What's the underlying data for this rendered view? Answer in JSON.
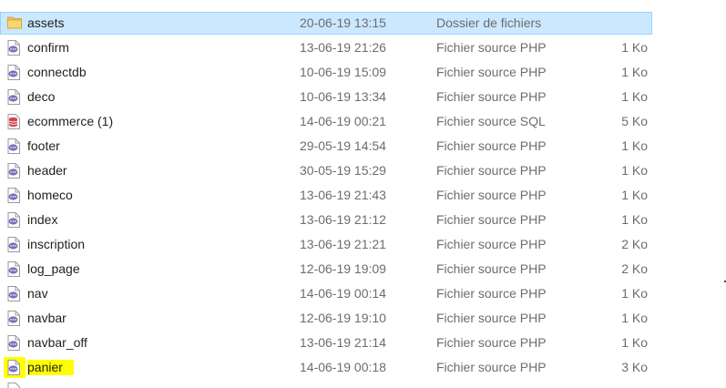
{
  "files": [
    {
      "name": "assets",
      "modified": "20-06-19 13:15",
      "type": "Dossier de fichiers",
      "size": "",
      "icon": "folder-icon",
      "selected": true,
      "highlighted": false
    },
    {
      "name": "confirm",
      "modified": "13-06-19 21:26",
      "type": "Fichier source PHP",
      "size": "1 Ko",
      "icon": "php-file-icon",
      "selected": false,
      "highlighted": false
    },
    {
      "name": "connectdb",
      "modified": "10-06-19 15:09",
      "type": "Fichier source PHP",
      "size": "1 Ko",
      "icon": "php-file-icon",
      "selected": false,
      "highlighted": false
    },
    {
      "name": "deco",
      "modified": "10-06-19 13:34",
      "type": "Fichier source PHP",
      "size": "1 Ko",
      "icon": "php-file-icon",
      "selected": false,
      "highlighted": false
    },
    {
      "name": "ecommerce (1)",
      "modified": "14-06-19 00:21",
      "type": "Fichier source SQL",
      "size": "5 Ko",
      "icon": "sql-file-icon",
      "selected": false,
      "highlighted": false
    },
    {
      "name": "footer",
      "modified": "29-05-19 14:54",
      "type": "Fichier source PHP",
      "size": "1 Ko",
      "icon": "php-file-icon",
      "selected": false,
      "highlighted": false
    },
    {
      "name": "header",
      "modified": "30-05-19 15:29",
      "type": "Fichier source PHP",
      "size": "1 Ko",
      "icon": "php-file-icon",
      "selected": false,
      "highlighted": false
    },
    {
      "name": "homeco",
      "modified": "13-06-19 21:43",
      "type": "Fichier source PHP",
      "size": "1 Ko",
      "icon": "php-file-icon",
      "selected": false,
      "highlighted": false
    },
    {
      "name": "index",
      "modified": "13-06-19 21:12",
      "type": "Fichier source PHP",
      "size": "1 Ko",
      "icon": "php-file-icon",
      "selected": false,
      "highlighted": false
    },
    {
      "name": "inscription",
      "modified": "13-06-19 21:21",
      "type": "Fichier source PHP",
      "size": "2 Ko",
      "icon": "php-file-icon",
      "selected": false,
      "highlighted": false
    },
    {
      "name": "log_page",
      "modified": "12-06-19 19:09",
      "type": "Fichier source PHP",
      "size": "2 Ko",
      "icon": "php-file-icon",
      "selected": false,
      "highlighted": false
    },
    {
      "name": "nav",
      "modified": "14-06-19 00:14",
      "type": "Fichier source PHP",
      "size": "1 Ko",
      "icon": "php-file-icon",
      "selected": false,
      "highlighted": false
    },
    {
      "name": "navbar",
      "modified": "12-06-19 19:10",
      "type": "Fichier source PHP",
      "size": "1 Ko",
      "icon": "php-file-icon",
      "selected": false,
      "highlighted": false
    },
    {
      "name": "navbar_off",
      "modified": "13-06-19 21:14",
      "type": "Fichier source PHP",
      "size": "1 Ko",
      "icon": "php-file-icon",
      "selected": false,
      "highlighted": false
    },
    {
      "name": "panier",
      "modified": "14-06-19 00:18",
      "type": "Fichier source PHP",
      "size": "3 Ko",
      "icon": "php-file-icon",
      "selected": false,
      "highlighted": true
    }
  ],
  "colors": {
    "selection_bg": "#cce8ff",
    "selection_border": "#99d1ff",
    "highlight": "#ffff00",
    "secondary_text": "#6d6d6d",
    "php_badge": "#7b6fb8",
    "sql_badge": "#d0454c",
    "folder": "#f4c453"
  }
}
